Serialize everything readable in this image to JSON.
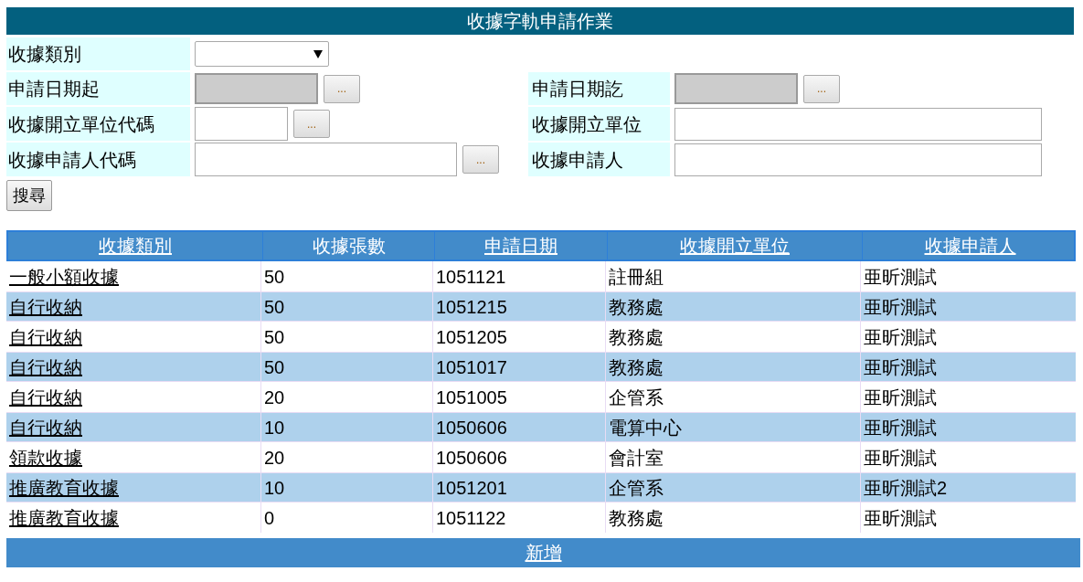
{
  "title": "收據字軌申請作業",
  "form": {
    "rows": [
      {
        "left": {
          "label": "收據類別",
          "kind": "select"
        },
        "right": null
      },
      {
        "left": {
          "label": "申請日期起",
          "kind": "date",
          "disabled": true,
          "picker": "..."
        },
        "right": {
          "label": "申請日期訖",
          "kind": "date",
          "disabled": true,
          "picker": "..."
        }
      },
      {
        "left": {
          "label": "收據開立單位代碼",
          "kind": "short",
          "disabled": false,
          "picker": "..."
        },
        "right": {
          "label": "收據開立單位",
          "kind": "wide",
          "disabled": false
        }
      },
      {
        "left": {
          "label": "收據申請人代碼",
          "kind": "medium",
          "disabled": false,
          "picker": "..."
        },
        "right": {
          "label": "收據申請人",
          "kind": "wide",
          "disabled": false
        }
      }
    ]
  },
  "search_button": "搜尋",
  "table": {
    "columns": [
      {
        "label": "收據類別",
        "sortable": true
      },
      {
        "label": "收據張數",
        "sortable": false
      },
      {
        "label": "申請日期",
        "sortable": true
      },
      {
        "label": "收據開立單位",
        "sortable": true
      },
      {
        "label": "收據申請人",
        "sortable": true
      }
    ],
    "rows": [
      [
        "一般小額收據",
        "50",
        "1051121",
        "註冊組",
        "亜昕測試"
      ],
      [
        "自行收納",
        "50",
        "1051215",
        "教務處",
        "亜昕測試"
      ],
      [
        "自行收納",
        "50",
        "1051205",
        "教務處",
        "亜昕測試"
      ],
      [
        "自行收納",
        "50",
        "1051017",
        "教務處",
        "亜昕測試"
      ],
      [
        "自行收納",
        "20",
        "1051005",
        "企管系",
        "亜昕測試"
      ],
      [
        "自行收納",
        "10",
        "1050606",
        "電算中心",
        "亜昕測試"
      ],
      [
        "領款收據",
        "20",
        "1050606",
        "會計室",
        "亜昕測試"
      ],
      [
        "推廣教育收據",
        "10",
        "1051201",
        "企管系",
        "亜昕測試2"
      ],
      [
        "推廣教育收據",
        "0",
        "1051122",
        "教務處",
        "亜昕測試"
      ]
    ]
  },
  "add_button": "新增"
}
